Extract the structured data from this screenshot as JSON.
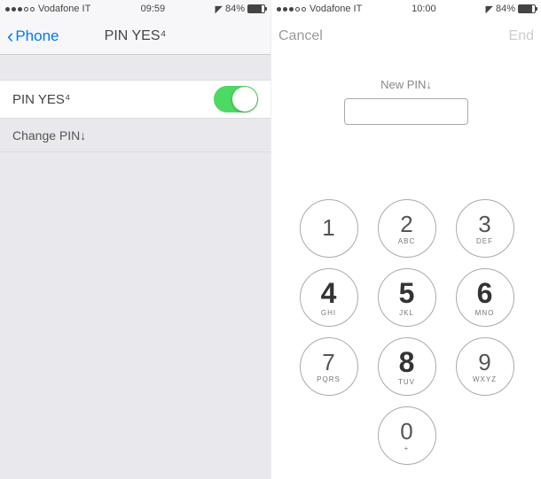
{
  "left": {
    "status": {
      "carrier": "Vodafone IT",
      "time": "09:59",
      "battery_pct": "84%"
    },
    "nav": {
      "back": "Phone",
      "title": "PIN YES⁴"
    },
    "rows": {
      "pin_toggle_label": "PIN YES⁴",
      "change_pin_label": "Change PIN↓"
    }
  },
  "right": {
    "status": {
      "carrier": "Vodafone IT",
      "time": "10:00",
      "battery_pct": "84%"
    },
    "nav": {
      "cancel": "Cancel",
      "end": "End"
    },
    "pin": {
      "label": "New PIN↓",
      "value": ""
    },
    "keypad": [
      {
        "num": "1",
        "letters": ""
      },
      {
        "num": "2",
        "letters": "ABC"
      },
      {
        "num": "3",
        "letters": "DEF"
      },
      {
        "num": "4",
        "letters": "GHI"
      },
      {
        "num": "5",
        "letters": "JKL"
      },
      {
        "num": "6",
        "letters": "MNO"
      },
      {
        "num": "7",
        "letters": "PQRS"
      },
      {
        "num": "8",
        "letters": "TUV"
      },
      {
        "num": "9",
        "letters": "WXYZ"
      },
      {
        "num": "0",
        "letters": "+"
      }
    ]
  }
}
